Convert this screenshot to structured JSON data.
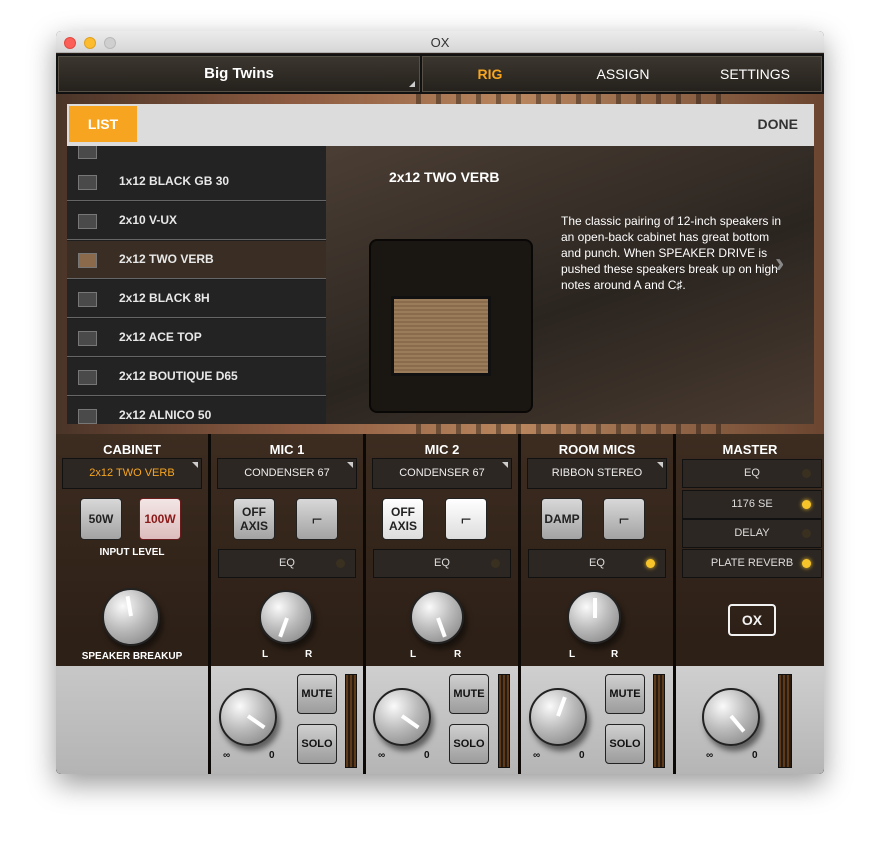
{
  "window": {
    "title": "OX"
  },
  "topbar": {
    "preset": "Big Twins",
    "tabs": [
      "RIG",
      "ASSIGN",
      "SETTINGS"
    ]
  },
  "list_panel": {
    "list_button": "LIST",
    "done_button": "DONE",
    "cabinets": [
      "1x12 BLACK GB 30",
      "2x10 V-UX",
      "2x12 TWO VERB",
      "2x12 BLACK 8H",
      "2x12 ACE TOP",
      "2x12 BOUTIQUE D65",
      "2x12 ALNICO 50"
    ],
    "selected_index": 2,
    "detail": {
      "name": "2x12 TWO VERB",
      "description": "The classic pairing of 12-inch speakers in an open-back cabinet has great bottom and punch. When SPEAKER DRIVE is pushed these speakers break up on high notes around A and C♯."
    }
  },
  "mixer": {
    "cabinet": {
      "title": "CABINET",
      "selected": "2x12 TWO VERB",
      "btn_50w": "50W",
      "btn_100w": "100W",
      "input_level": "INPUT LEVEL",
      "speaker_breakup": "SPEAKER BREAKUP"
    },
    "mic1": {
      "title": "MIC 1",
      "mic": "CONDENSER 67",
      "off_axis": "OFF AXIS",
      "eq": "EQ"
    },
    "mic2": {
      "title": "MIC 2",
      "mic": "CONDENSER 67",
      "off_axis": "OFF AXIS",
      "eq": "EQ"
    },
    "room": {
      "title": "ROOM MICS",
      "mic": "RIBBON STEREO",
      "damp": "DAMP",
      "eq": "EQ"
    },
    "master": {
      "title": "MASTER",
      "fx": [
        "EQ",
        "1176 SE",
        "DELAY",
        "PLATE REVERB"
      ],
      "logo": "OX"
    },
    "labels": {
      "l": "L",
      "r": "R",
      "inf": "∞",
      "zero": "0",
      "mute": "MUTE",
      "solo": "SOLO"
    }
  },
  "colors": {
    "accent": "#f7a520",
    "led_on": "#f7c52a"
  }
}
